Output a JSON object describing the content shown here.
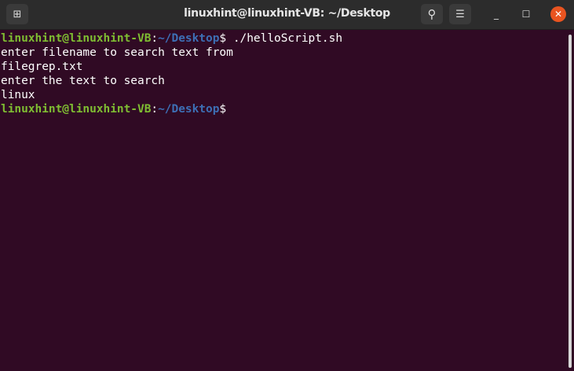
{
  "window": {
    "title": "linuxhint@linuxhint-VB: ~/Desktop"
  },
  "icons": {
    "new_tab": "new-tab-icon",
    "search": "search-icon",
    "menu": "hamburger-menu-icon",
    "minimize": "minimize-icon",
    "maximize": "maximize-icon",
    "close": "close-icon"
  },
  "terminal": {
    "user_host": "linuxhint@linuxhint-VB",
    "path": "~/Desktop",
    "prompt_symbol": "$",
    "lines": [
      {
        "type": "prompt",
        "command": " ./helloScript.sh"
      },
      {
        "type": "output",
        "text": "enter filename to search text from"
      },
      {
        "type": "output",
        "text": "filegrep.txt"
      },
      {
        "type": "output",
        "text": "enter the text to search"
      },
      {
        "type": "output",
        "text": "linux"
      },
      {
        "type": "prompt",
        "command": ""
      }
    ]
  },
  "colors": {
    "background": "#300a24",
    "user_host": "#7fbd32",
    "path": "#3d6fb5",
    "close": "#e95420"
  }
}
